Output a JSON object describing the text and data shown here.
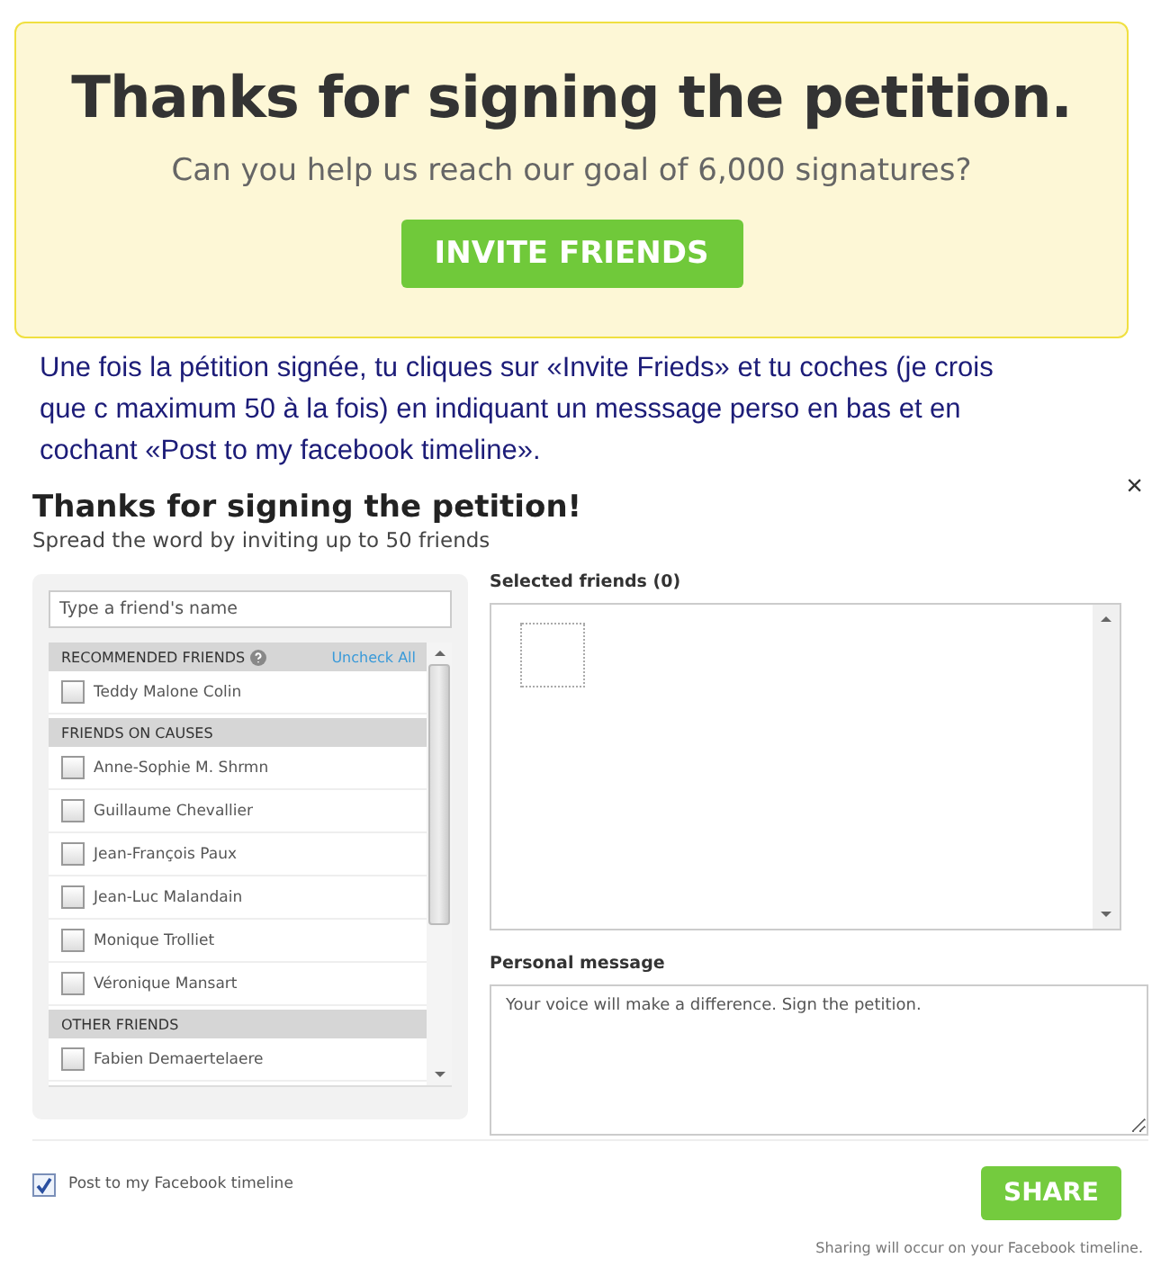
{
  "banner": {
    "title": "Thanks for signing the petition.",
    "subtitle": "Can you help us reach our goal of 6,000 signatures?",
    "button": "INVITE FRIENDS"
  },
  "annotation": "Une fois la pétition signée, tu cliques sur «Invite Frieds» et tu coches (je crois que c maximum 50 à la fois) en indiquant un messsage perso en bas et en cochant «Post to my facebook timeline».",
  "dialog": {
    "close": "×",
    "title": "Thanks for signing the petition!",
    "subtitle": "Spread the word by inviting up to 50 friends",
    "search": {
      "placeholder": "Type a friend's name"
    },
    "groups": [
      {
        "title": "RECOMMENDED FRIENDS",
        "action": "Uncheck All",
        "help": true,
        "friends": [
          {
            "name": "Teddy Malone Colin",
            "checked": false
          }
        ]
      },
      {
        "title": "FRIENDS ON CAUSES",
        "friends": [
          {
            "name": "Anne-Sophie M. Shrmn",
            "checked": false
          },
          {
            "name": "Guillaume Chevallier",
            "checked": false
          },
          {
            "name": "Jean-François Paux",
            "checked": false
          },
          {
            "name": "Jean-Luc Malandain",
            "checked": false
          },
          {
            "name": "Monique Trolliet",
            "checked": false
          },
          {
            "name": "Véronique Mansart",
            "checked": false
          }
        ]
      },
      {
        "title": "OTHER FRIENDS",
        "friends": [
          {
            "name": "Fabien Demaertelaere",
            "checked": false
          }
        ]
      }
    ],
    "selected_label": "Selected friends (0)",
    "message_label": "Personal message",
    "message": "Your voice will make a difference. Sign the petition.",
    "post_timeline": {
      "label": "Post to my Facebook timeline",
      "checked": true
    },
    "share": "SHARE",
    "footnote": "Sharing will occur on your Facebook timeline."
  }
}
